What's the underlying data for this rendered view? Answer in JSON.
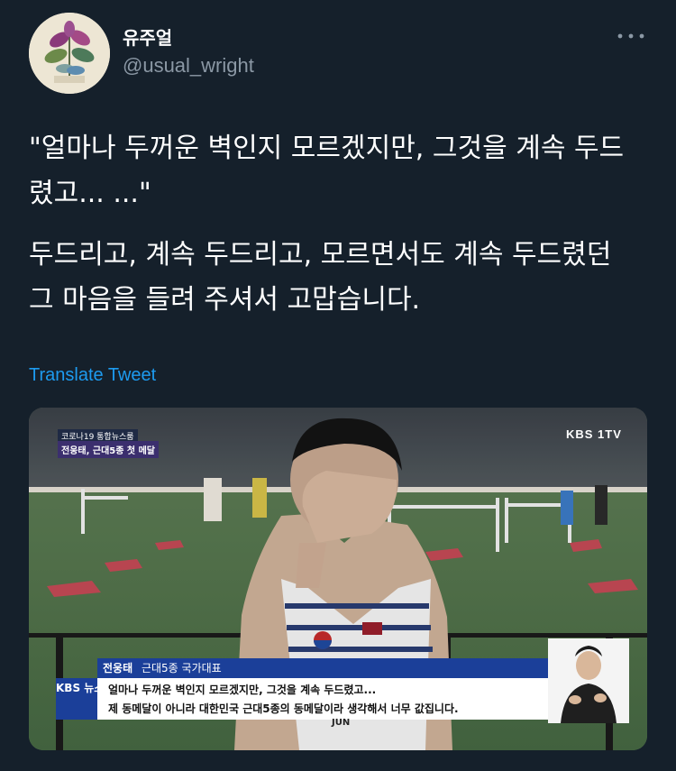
{
  "author": {
    "display_name": "유주얼",
    "handle": "@usual_wright"
  },
  "icons": {
    "more": "more-horizontal-icon"
  },
  "tweet": {
    "paragraph_1": "\"얼마나 두꺼운 벽인지 모르겠지만, 그것을 계속 두드렸고... ...\"",
    "paragraph_2": "두드리고, 계속 두드리고, 모르면서도 계속 두드렸던 그 마음을 들려 주셔서 고맙습니다.",
    "translate_label": "Translate Tweet"
  },
  "media": {
    "top_tag_line1": "코로나19 통합뉴스룸",
    "top_tag_line2": "전웅태, 근대5종 첫 메달",
    "broadcaster_logo": "KBS 1TV",
    "caption_name": "전웅태",
    "caption_title": "근대5종 국가대표",
    "news_badge": "KBS 뉴스",
    "caption_line_1": "얼마나 두꺼운 벽인지 모르겠지만, 그것을 계속 두드렸고...",
    "caption_line_2": "제 동메달이 아니라 대한민국 근대5종의 동메달이라 생각해서 너무 값집니다.",
    "bib_text": "JUN"
  },
  "colors": {
    "background": "#15202b",
    "link": "#1d9bf0",
    "secondary_text": "#8b98a5"
  }
}
